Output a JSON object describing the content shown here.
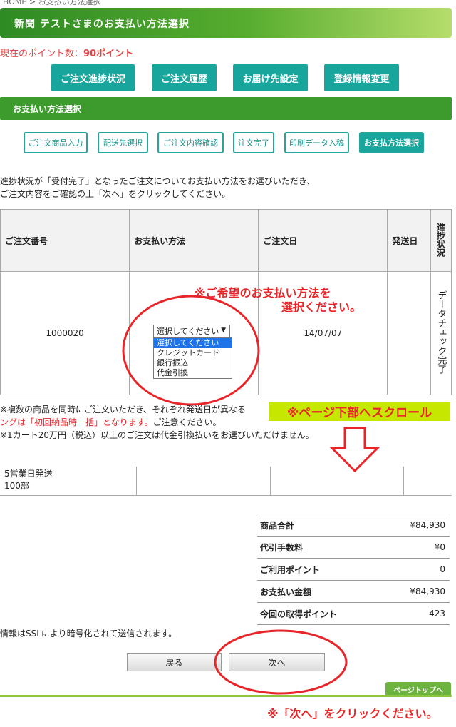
{
  "breadcrumb": "HOME > お支払い方法選択",
  "header": {
    "title": "新聞 テストさまのお支払い方法選択"
  },
  "points": {
    "label": "現在のポイント数：",
    "value": "90ポイント"
  },
  "nav": [
    "ご注文進捗状況",
    "ご注文履歴",
    "お届け先設定",
    "登録情報変更"
  ],
  "section": {
    "title": "お支払い方法選択"
  },
  "steps": [
    "ご注文商品入力",
    "配送先選択",
    "ご注文内容確認",
    "注文完了",
    "印刷データ入稿",
    "お支払方法選択"
  ],
  "intro": {
    "line1": "進捗状況が「受付完了」となったご注文についてお支払い方法をお選びいただき、",
    "line2": "ご注文内容をご確認の上「次へ」をクリックしてください。"
  },
  "orders_table": {
    "headers": [
      "ご注文番号",
      "お支払い方法",
      "ご注文日",
      "発送日",
      "進捗状況"
    ],
    "row": {
      "order_no": "1000020",
      "payment_selected": "選択してください",
      "order_date": "14/07/07",
      "ship_date": "",
      "status": "データチェック完了"
    }
  },
  "payment_options": [
    "選択してください",
    "クレジットカード",
    "銀行振込",
    "代金引換"
  ],
  "annotations": {
    "select_hint_line1": "※ご希望のお支払い方法を",
    "select_hint_line2": "選択ください。",
    "scroll_hint": "※ページ下部へスクロール",
    "next_hint": "※「次へ」をクリックください。"
  },
  "notes": {
    "line1": "※複数の商品を同時にご注文いただき、それぞれ発送日が異なる",
    "line2_red": "ングは「初回納品時一括」となります。",
    "line2_rest": "ご注意ください。",
    "line3": "※1カート20万円（税込）以上のご注文は代金引換払いをお選びいただけません。"
  },
  "items_row": {
    "shipping": "5営業日発送",
    "quantity": "100部"
  },
  "summary": [
    {
      "label": "商品合計",
      "value": "¥84,930"
    },
    {
      "label": "代引手数料",
      "value": "¥0"
    },
    {
      "label": "ご利用ポイント",
      "value": "0"
    },
    {
      "label": "お支払い金額",
      "value": "¥84,930"
    },
    {
      "label": "今回の取得ポイント",
      "value": "423"
    }
  ],
  "ssl_note": "情報はSSLにより暗号化されて送信されます。",
  "buttons": {
    "back": "戻る",
    "next": "次へ"
  },
  "page_top": "ページトップへ",
  "colors": {
    "accent": "#18a59c",
    "green": "#3c9b2c",
    "red": "#e8262a",
    "highlight": "#c6e800"
  }
}
